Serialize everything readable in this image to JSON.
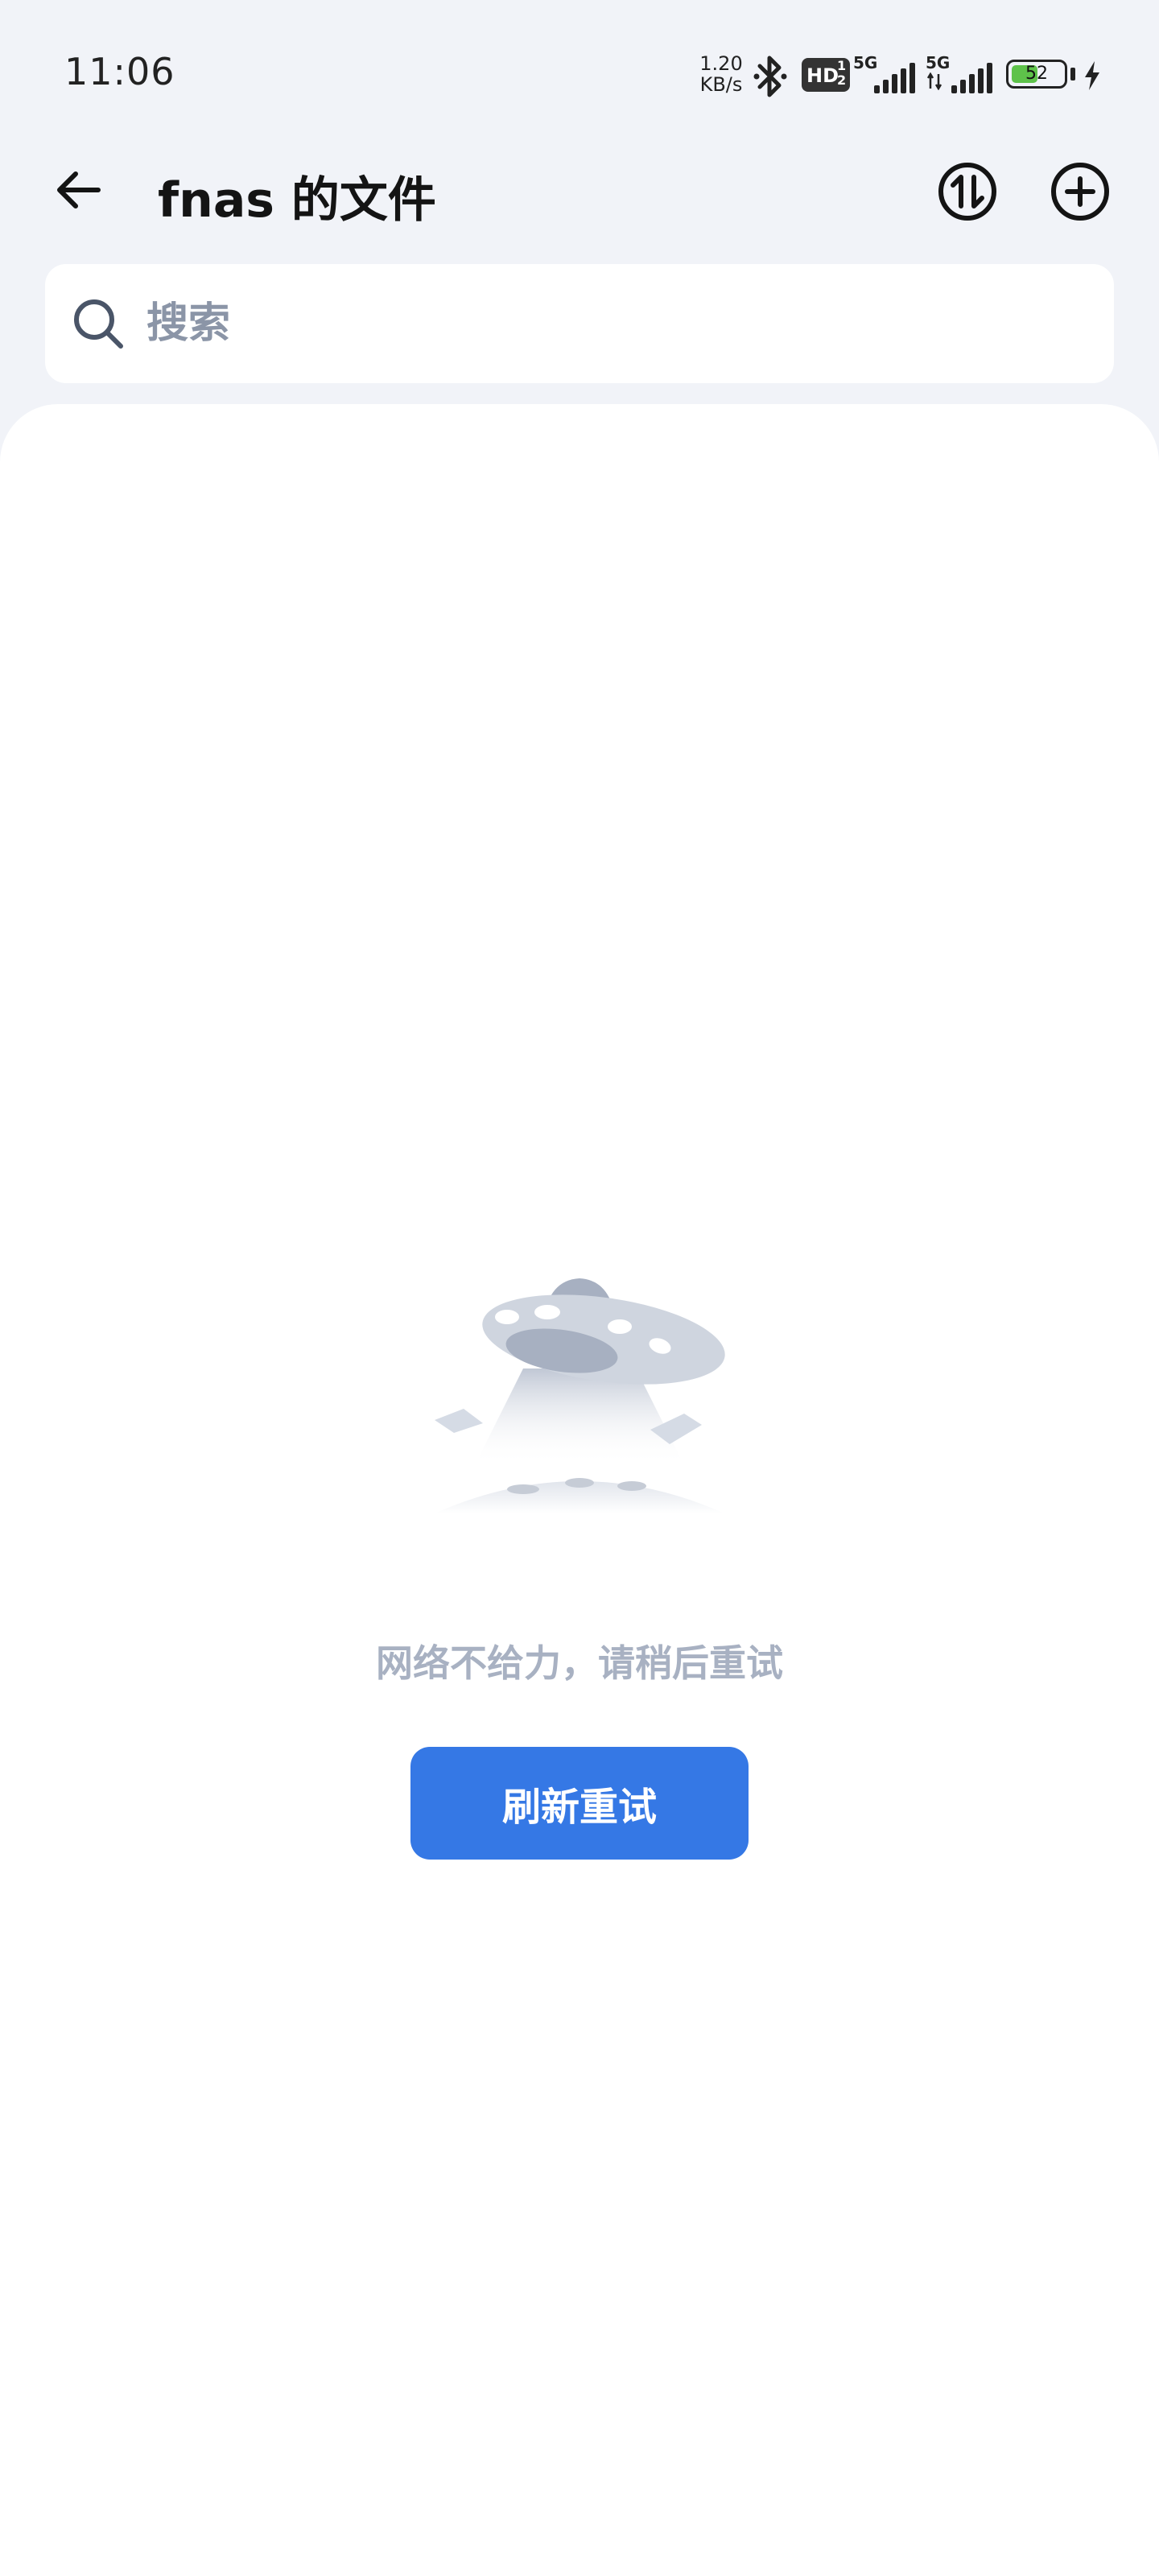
{
  "status_bar": {
    "time": "11:06",
    "net_speed_value": "1.20",
    "net_speed_unit": "KB/s",
    "hd_label": "HD",
    "hd_sup": "1",
    "hd_sub": "2",
    "signal_1_label": "5G",
    "signal_2_label": "5G",
    "battery_level": "52",
    "battery_color": "#5ec24a"
  },
  "header": {
    "title": "fnas 的文件",
    "back_icon": "arrow-left-icon",
    "transfer_icon": "transfer-arrows-icon",
    "add_icon": "plus-circle-icon"
  },
  "search": {
    "placeholder": "搜索",
    "value": ""
  },
  "empty_state": {
    "illustration": "ufo-icon",
    "message": "网络不给力，请稍后重试",
    "button_label": "刷新重试"
  },
  "colors": {
    "accent": "#3578e5",
    "page_background": "#f1f3f8",
    "message_gray": "#a8b1c2"
  }
}
